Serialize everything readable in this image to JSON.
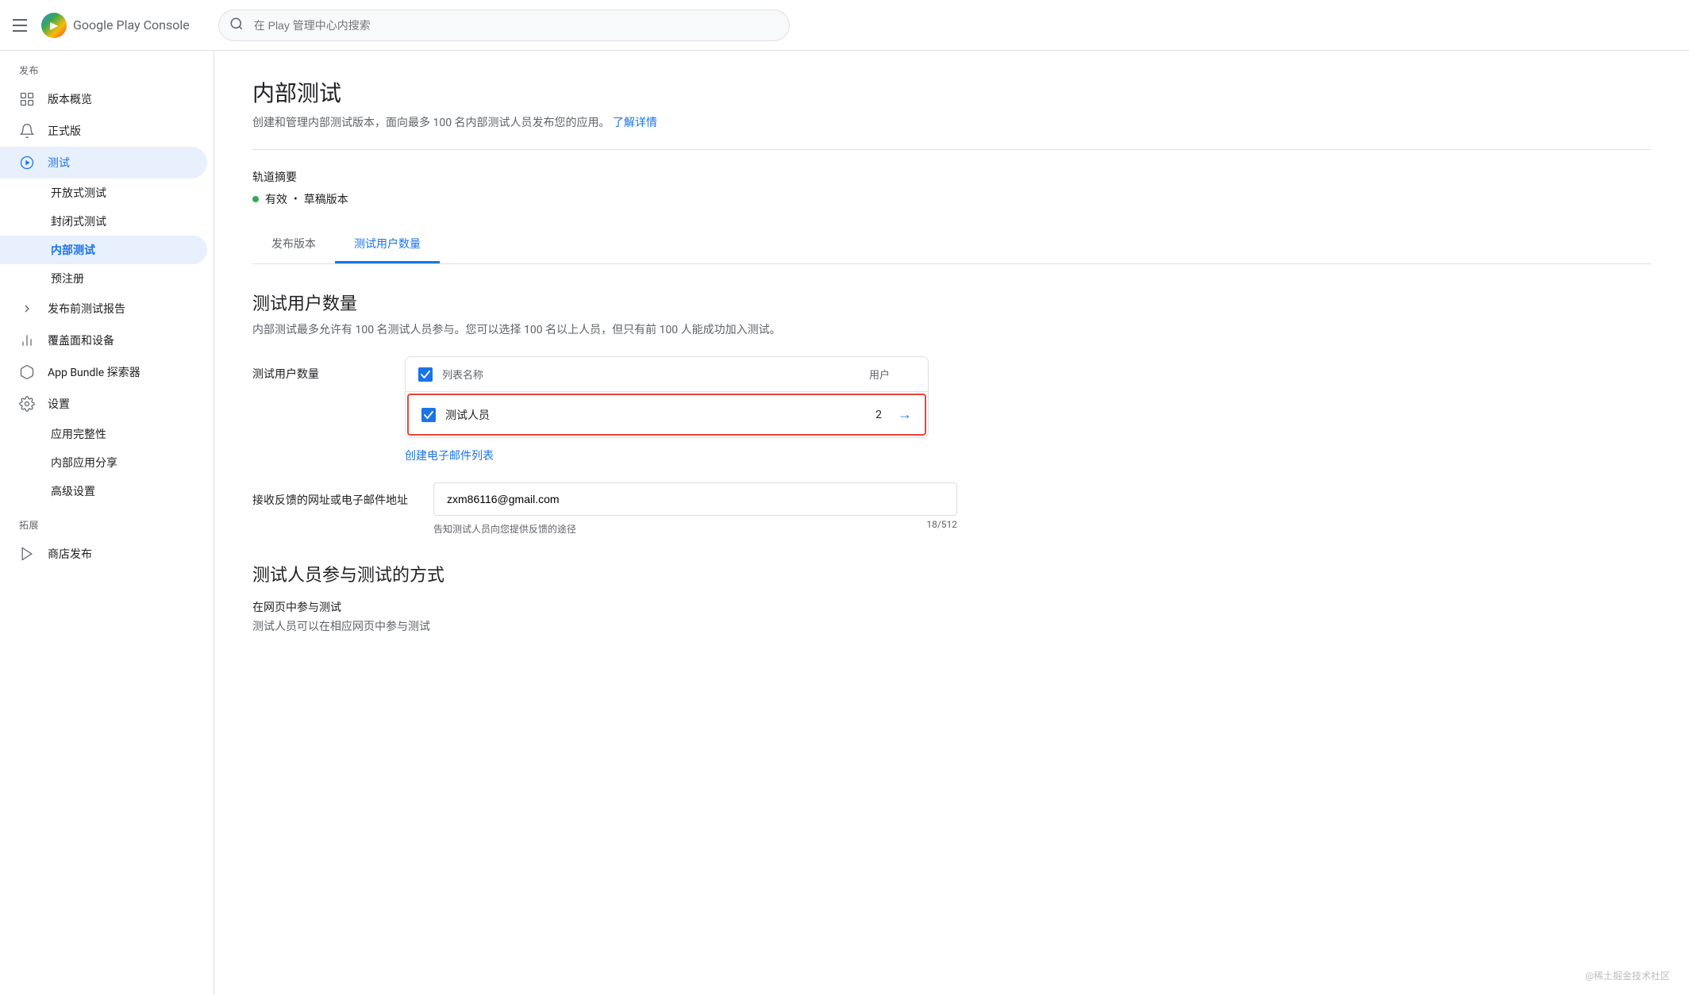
{
  "topbar": {
    "menu_icon_label": "menu",
    "logo_text": "Google Play Console",
    "search_placeholder": "在 Play 管理中心内搜索"
  },
  "sidebar": {
    "section_release": "发布",
    "items": [
      {
        "id": "versions-overview",
        "label": "版本概览",
        "icon": "grid-icon",
        "active": false
      },
      {
        "id": "production",
        "label": "正式版",
        "icon": "bell-icon",
        "active": false
      },
      {
        "id": "testing",
        "label": "测试",
        "icon": "circle-play-icon",
        "active": true
      },
      {
        "id": "open-testing",
        "label": "开放式测试",
        "sub": true,
        "active": false
      },
      {
        "id": "closed-testing",
        "label": "封闭式测试",
        "sub": true,
        "active": false
      },
      {
        "id": "internal-testing",
        "label": "内部测试",
        "sub": true,
        "active": true
      },
      {
        "id": "pre-registration",
        "label": "预注册",
        "sub": true,
        "active": false
      },
      {
        "id": "pre-launch-report",
        "label": "发布前测试报告",
        "sub": false,
        "hasChevron": true,
        "active": false
      }
    ],
    "section_analysis": "",
    "items2": [
      {
        "id": "coverage-devices",
        "label": "覆盖面和设备",
        "icon": "chart-icon",
        "active": false
      },
      {
        "id": "app-bundle",
        "label": "App Bundle 探索器",
        "icon": "package-icon",
        "active": false
      }
    ],
    "section_settings": "",
    "items3": [
      {
        "id": "settings",
        "label": "设置",
        "icon": "gear-icon",
        "active": false
      },
      {
        "id": "app-integrity",
        "label": "应用完整性",
        "sub": true,
        "active": false
      },
      {
        "id": "internal-sharing",
        "label": "内部应用分享",
        "sub": true,
        "active": false
      },
      {
        "id": "advanced-settings",
        "label": "高级设置",
        "sub": true,
        "active": false
      }
    ],
    "section_expand": "拓展",
    "items4": [
      {
        "id": "store-publish",
        "label": "商店发布",
        "icon": "play-icon",
        "active": false
      }
    ]
  },
  "main": {
    "page_title": "内部测试",
    "page_subtitle": "创建和管理内部测试版本，面向最多 100 名内部测试人员发布您的应用。",
    "learn_more": "了解详情",
    "track_summary_label": "轨道摘要",
    "track_status": "有效",
    "track_sep": "•",
    "track_draft": "草稿版本",
    "tabs": [
      {
        "id": "release-version",
        "label": "发布版本",
        "active": false
      },
      {
        "id": "testers-count",
        "label": "测试用户数量",
        "active": true
      }
    ],
    "section_title": "测试用户数量",
    "section_desc": "内部测试最多允许有 100 名测试人员参与。您可以选择 100 名以上人员，但只有前 100 人能成功加入测试。",
    "field_label": "测试用户数量",
    "table_header_list": "列表名称",
    "table_header_users": "用户",
    "tester_row": {
      "name": "测试人员",
      "users": "2"
    },
    "create_email_list": "创建电子邮件列表",
    "feedback_label": "接收反馈的网址或电子邮件地址",
    "feedback_value": "zxm86116@gmail.com",
    "feedback_hint": "告知测试人员向您提供反馈的途径",
    "feedback_count": "18/512",
    "participation_title": "测试人员参与测试的方式",
    "participation_web_title": "在网页中参与测试",
    "participation_web_desc": "测试人员可以在相应网页中参与测试",
    "watermark": "@稀土掘金技术社区"
  }
}
